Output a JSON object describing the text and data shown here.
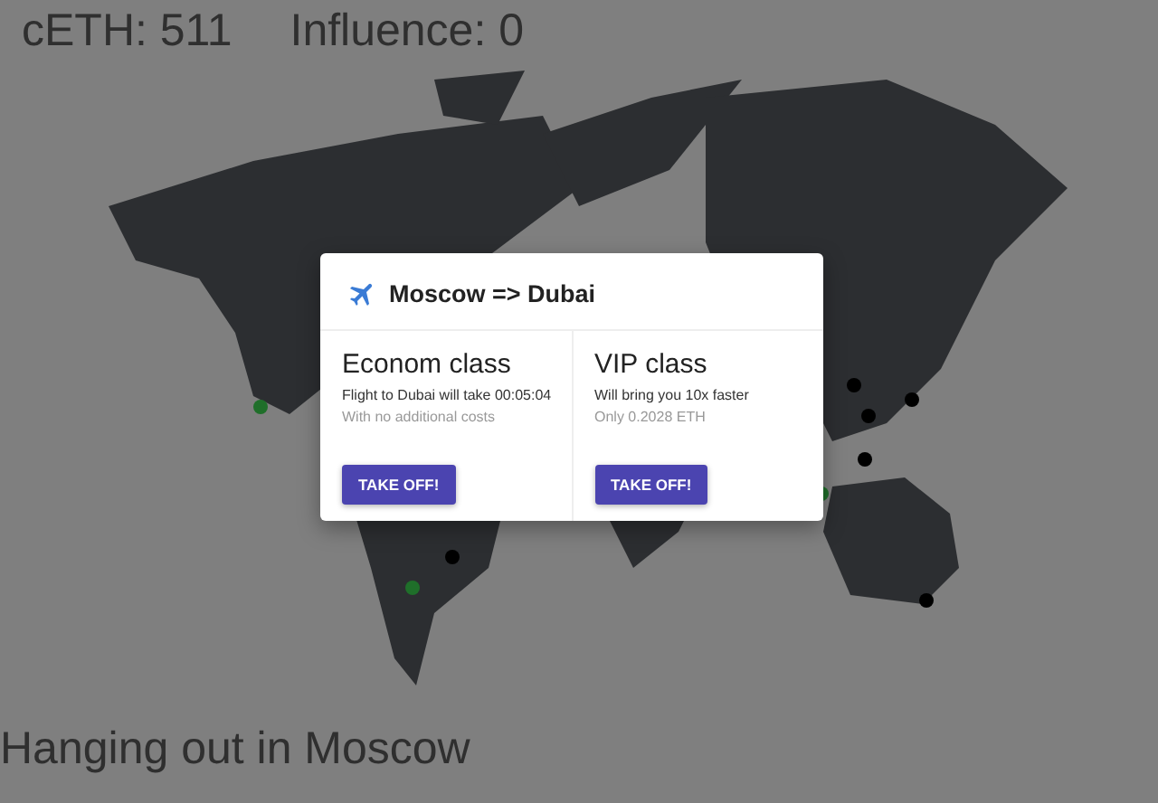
{
  "stats": [
    {
      "label": "cETH: 511"
    },
    {
      "label": "Influence: 0"
    }
  ],
  "dialog": {
    "title": "Moscow => Dubai",
    "options": [
      {
        "title": "Econom class",
        "line_1": "Flight to Dubai will take 00:05:04",
        "line_2": "With no additional costs",
        "button": "TAKE OFF!"
      },
      {
        "title": "VIP class",
        "line_1": "Will bring you 10x faster",
        "line_2": "Only 0.2028 ETH",
        "button": "TAKE OFF!"
      }
    ]
  },
  "status": "Hanging out in Moscow"
}
